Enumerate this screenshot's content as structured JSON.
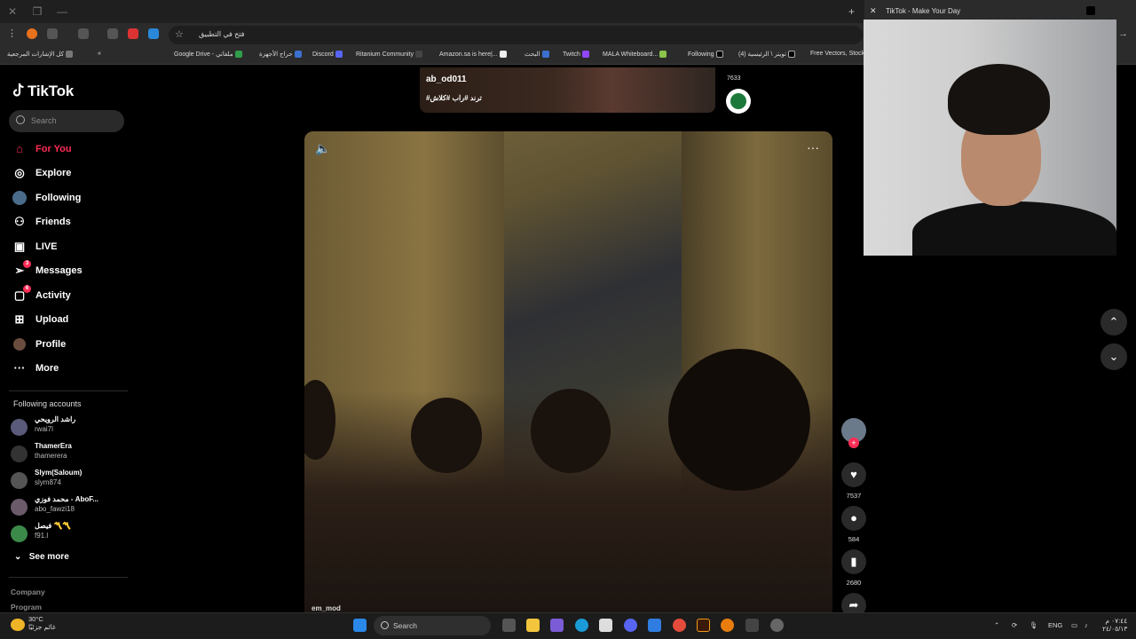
{
  "browser": {
    "tab_title": "TikTok - Make Your Day",
    "omnibox_text": "فتح في التطبيق",
    "bookmarks": [
      "كل الإشارات المرجعية",
      "Google Drive - ملفاتي",
      "حراج الأجهزة",
      "Discord",
      "Ritanium Community",
      "Amazon.sa is here|...",
      "البحث",
      "Twitch",
      "MALA Whiteboard...",
      "Following",
      "(4) تويتر \\ الرئيسية",
      "Free Vectors, Stock"
    ]
  },
  "sidebar": {
    "logo": "TikTok",
    "search_placeholder": "Search",
    "nav": [
      {
        "label": "For You",
        "icon": "home-icon"
      },
      {
        "label": "Explore",
        "icon": "compass-icon"
      },
      {
        "label": "Following",
        "icon": "following-icon"
      },
      {
        "label": "Friends",
        "icon": "friends-icon"
      },
      {
        "label": "LIVE",
        "icon": "live-icon"
      },
      {
        "label": "Messages",
        "icon": "messages-icon",
        "badge": "3"
      },
      {
        "label": "Activity",
        "icon": "activity-icon",
        "badge": "6"
      },
      {
        "label": "Upload",
        "icon": "upload-icon"
      },
      {
        "label": "Profile",
        "icon": "avatar"
      },
      {
        "label": "More",
        "icon": "more-icon"
      }
    ],
    "following_title": "Following accounts",
    "accounts": [
      {
        "name": "راشد الرويحي",
        "handle": "rwai7l"
      },
      {
        "name": "ThamerEra",
        "handle": "thamerera"
      },
      {
        "name": "Slym(Saloum)",
        "handle": "slym874"
      },
      {
        "name": "محمد فوزي - AboF...",
        "handle": "abo_fawzi18"
      },
      {
        "name": "فيصل 〽️〽️",
        "handle": "f91.l"
      }
    ],
    "see_more": "See more",
    "footer": [
      "Company",
      "Program"
    ]
  },
  "feed": {
    "prev_username": "ab_od011",
    "prev_tags": "#ترند #راب #كلاش",
    "prev_count": "7633",
    "video_user": "em_mod",
    "likes": "7537",
    "comments": "584",
    "saves": "2680"
  },
  "taskbar": {
    "temperature": "30°C",
    "weather_label": "غائم جزئيًا",
    "search_placeholder": "Search",
    "lang": "ENG",
    "time": "٠٧:٤٤ م",
    "date": "٢٤/٠٥/١٣"
  }
}
